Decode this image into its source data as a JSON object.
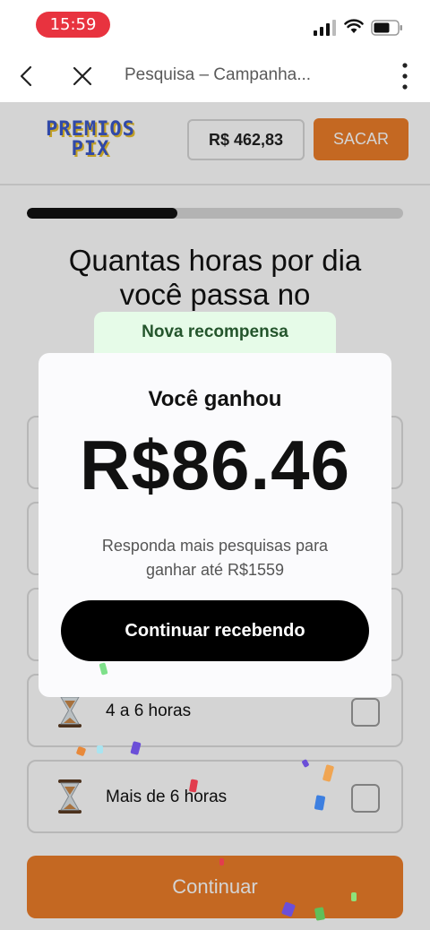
{
  "status_bar": {
    "time": "15:59"
  },
  "browser": {
    "title": "Pesquisa – Campanha..."
  },
  "header": {
    "logo_line1": "PREMIOS",
    "logo_line2": "PIX",
    "balance": "R$ 462,83",
    "withdraw_label": "SACAR"
  },
  "progress": {
    "fraction": 0.4
  },
  "question": {
    "line1": "Quantas horas por dia",
    "line2": "você passa no"
  },
  "options": [
    {
      "label": "4 a 6 horas"
    },
    {
      "label": "Mais de 6 horas"
    }
  ],
  "continue_label": "Continuar",
  "modal": {
    "tab_label": "Nova recompensa",
    "heading": "Você ganhou",
    "amount": "R$86.46",
    "message_line1": "Responda mais pesquisas para",
    "message_line2": "ganhar até R$1559",
    "button_label": "Continuar recebendo"
  },
  "colors": {
    "accent": "#ec7d2a",
    "time_pill": "#e8333f",
    "reward_tab": "#e6fbe8",
    "logo_blue": "#3c58c9",
    "logo_gold": "#eac12e"
  },
  "icons": [
    "signal-icon",
    "wifi-icon",
    "battery-icon",
    "back-icon",
    "close-icon",
    "more-icon",
    "hourglass-icon",
    "checkbox"
  ]
}
